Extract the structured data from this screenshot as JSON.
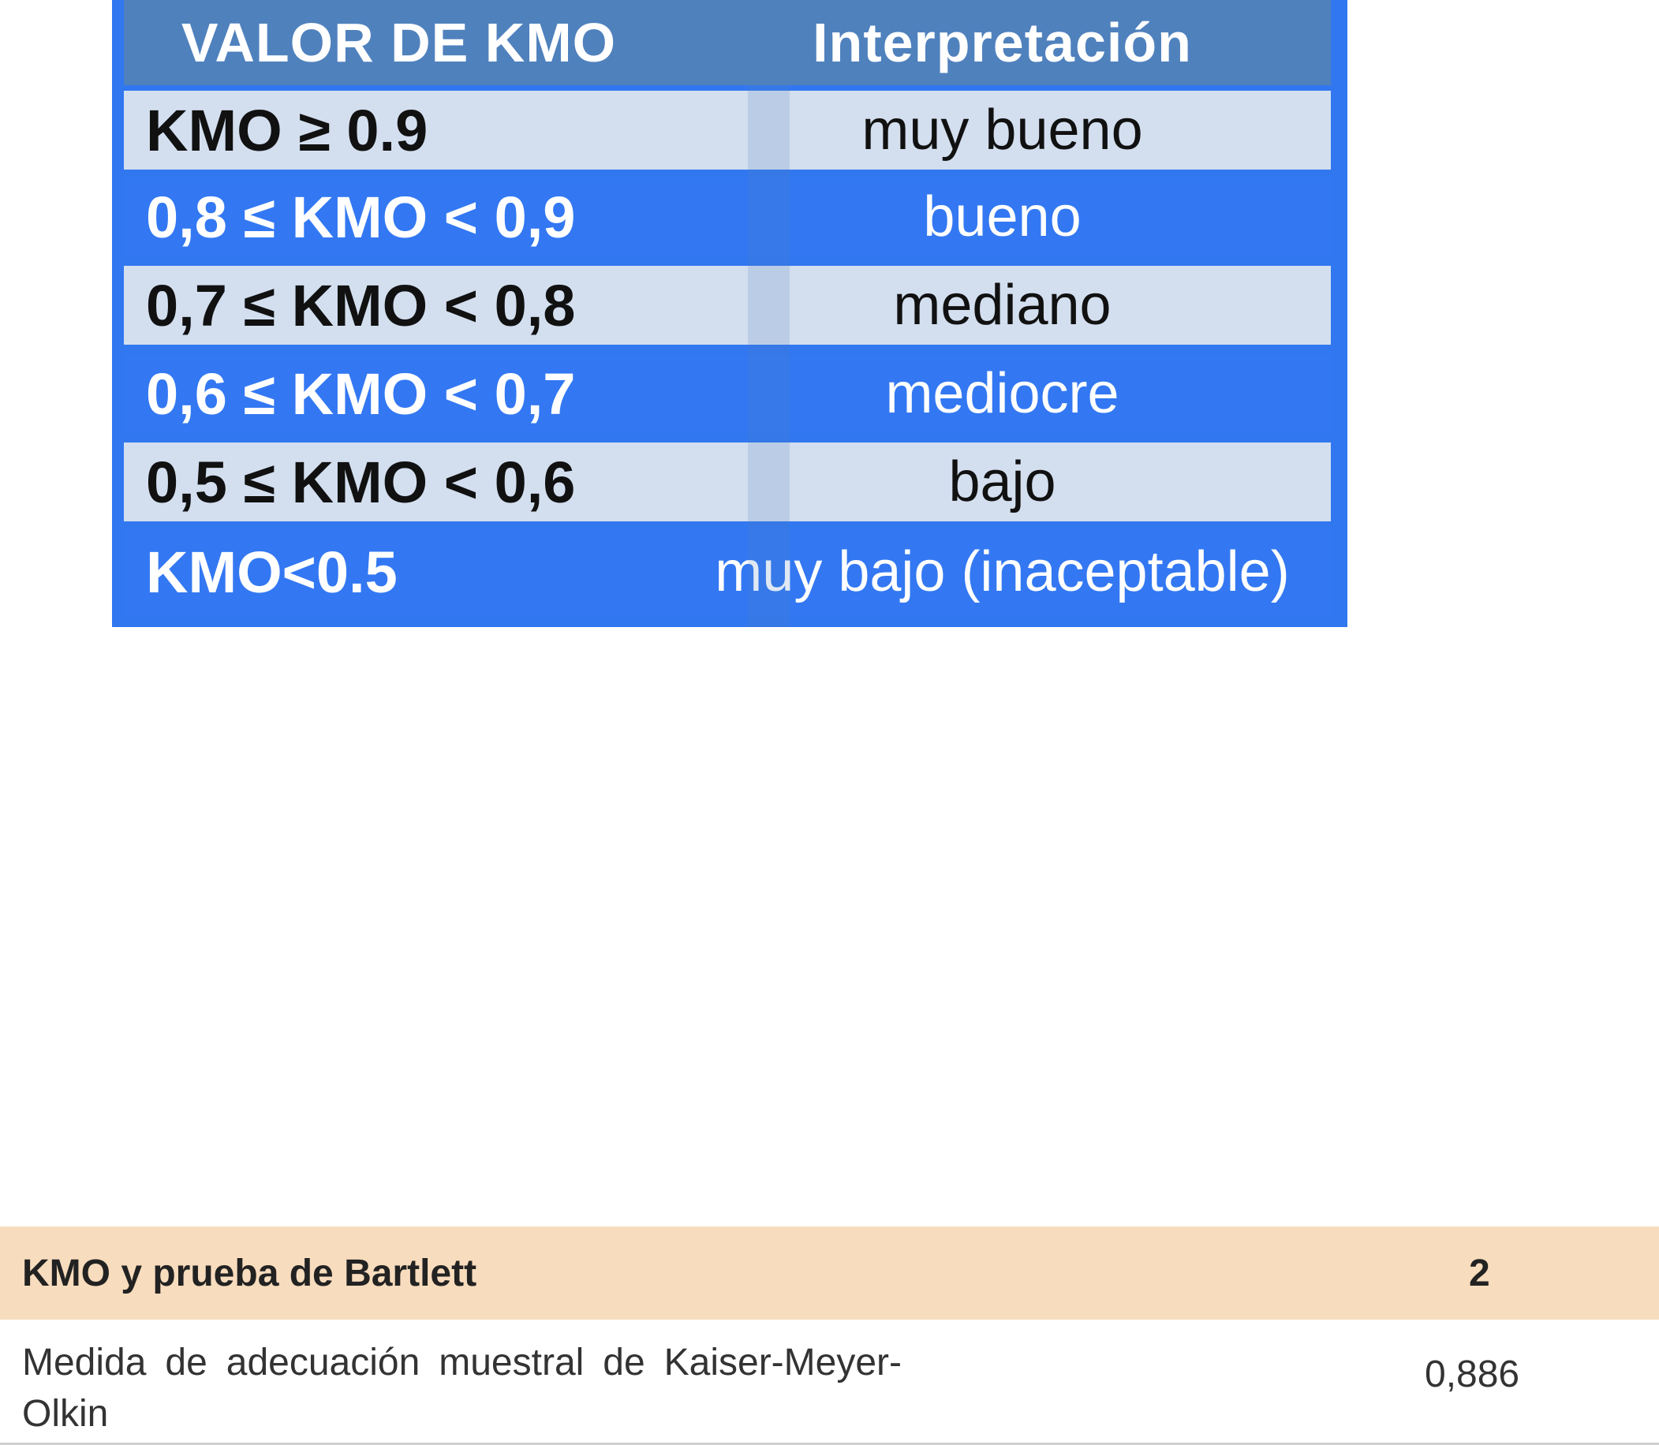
{
  "kmo_table": {
    "header": {
      "col1": "VALOR DE KMO",
      "col2": "Interpretación"
    },
    "rows": [
      {
        "range": "KMO ≥ 0.9",
        "interpretation": "muy bueno"
      },
      {
        "range": "0,8 ≤ KMO < 0,9",
        "interpretation": "bueno"
      },
      {
        "range": "0,7 ≤ KMO < 0,8",
        "interpretation": "mediano"
      },
      {
        "range": "0,6 ≤ KMO < 0,7",
        "interpretation": "mediocre"
      },
      {
        "range": "0,5 ≤ KMO < 0,6",
        "interpretation": "bajo"
      },
      {
        "range": "KMO<0.5",
        "interpretation": "muy bajo (inaceptable)"
      }
    ],
    "colors": {
      "frame": "#3177f0",
      "header": "#4f81bd",
      "row_light": "#d3dfef",
      "row_dark": "#3378f2"
    }
  },
  "spss_table": {
    "title": "KMO y prueba de Bartlett",
    "column_header": "2",
    "rows": [
      {
        "label": "Medida de adecuación muestral de Kaiser-Meyer-Olkin",
        "value": "0,886"
      }
    ],
    "colors": {
      "header": "#f7dcbd"
    }
  }
}
